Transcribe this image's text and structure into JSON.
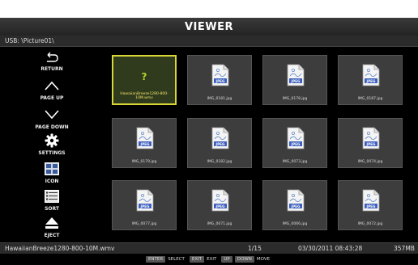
{
  "header": {
    "title": "VIEWER"
  },
  "path": {
    "text": "USB: \\Picture01\\"
  },
  "sidebar": {
    "items": [
      {
        "label": "RETURN",
        "icon": "return-icon"
      },
      {
        "label": "PAGE UP",
        "icon": "chevron-up-icon"
      },
      {
        "label": "PAGE DOWN",
        "icon": "chevron-down-icon"
      },
      {
        "label": "SETTINGS",
        "icon": "gear-icon"
      },
      {
        "label": "ICON",
        "icon": "grid-view-icon"
      },
      {
        "label": "SORT",
        "icon": "list-sort-icon"
      },
      {
        "label": "EJECT",
        "icon": "eject-icon"
      }
    ]
  },
  "grid": {
    "files": [
      {
        "name": "HawaiianBreeze1280-800-10M.wmv",
        "type": "unknown",
        "selected": true
      },
      {
        "name": "IMG_0181.jpg",
        "type": "JPEG"
      },
      {
        "name": "IMG_0178.jpg",
        "type": "JPEG"
      },
      {
        "name": "IMG_0187.jpg",
        "type": "JPEG"
      },
      {
        "name": "IMG_0179.jpg",
        "type": "JPEG"
      },
      {
        "name": "IMG_0182.jpg",
        "type": "JPEG"
      },
      {
        "name": "IMG_0073.jpg",
        "type": "JPEG"
      },
      {
        "name": "IMG_0074.jpg",
        "type": "JPEG"
      },
      {
        "name": "IMG_0077.jpg",
        "type": "JPEG"
      },
      {
        "name": "IMG_0071.jpg",
        "type": "JPEG"
      },
      {
        "name": "IMG_0066.jpg",
        "type": "JPEG"
      },
      {
        "name": "IMG_0072.jpg",
        "type": "JPEG"
      }
    ]
  },
  "status": {
    "filename": "HawaiianBreeze1280-800-10M.wmv",
    "page": "1/15",
    "datetime": "03/30/2011 08:43:28",
    "size": "357MB"
  },
  "keys": [
    {
      "key": "ENTER",
      "label": "SELECT"
    },
    {
      "key": "EXIT",
      "label": "EXIT"
    },
    {
      "key": "UP",
      "label": ""
    },
    {
      "key": "DOWN",
      "label": "MOVE"
    }
  ],
  "colors": {
    "selection": "#d8d63a",
    "jpeg_badge": "#3c5fbf",
    "tile_bg": "#3d3d3d"
  }
}
